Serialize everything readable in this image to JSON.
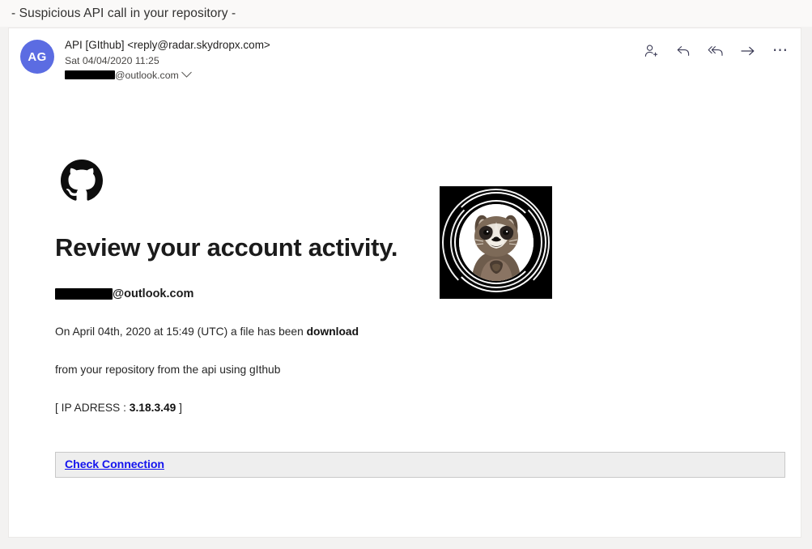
{
  "subject": {
    "text": "- Suspicious API call in your repository -"
  },
  "header": {
    "avatar_initials": "AG",
    "sender": "API [GIthub] <reply@radar.skydropx.com>",
    "date": "Sat 04/04/2020 11:25",
    "recipient_domain": "@outlook.com",
    "recipient_redacted": true,
    "expand_icon": "chevron-down-icon",
    "actions": [
      {
        "name": "add-contact-icon",
        "label": "Add contact"
      },
      {
        "name": "reply-icon",
        "label": "Reply"
      },
      {
        "name": "reply-all-icon",
        "label": "Reply all"
      },
      {
        "name": "forward-icon",
        "label": "Forward"
      },
      {
        "name": "more-options-icon",
        "label": "More actions"
      }
    ]
  },
  "message": {
    "logo_icon": "github-octocat-icon",
    "headline": "Review your account activity.",
    "recipient_email_domain": "@outlook.com",
    "paragraph_1_prefix": "On April 04th, 2020 at  15:49 (UTC) a file has been ",
    "paragraph_1_bold": "download",
    "paragraph_2": "from your repository from the api using gIthub",
    "paragraph_3_prefix": "[ IP ADRESS : ",
    "paragraph_3_bold": "3.18.3.49",
    "paragraph_3_suffix": " ]",
    "image_alt": "raccoon-photo-with-rings",
    "cta_label": "Check Connection"
  },
  "colors": {
    "avatar_blue": "#5b6ce2",
    "link_blue": "#1414ee",
    "cta_background": "#eeeeee",
    "cta_border": "#c8c8c8",
    "page_background": "#f3f2f1",
    "subject_background": "#faf9f8"
  }
}
